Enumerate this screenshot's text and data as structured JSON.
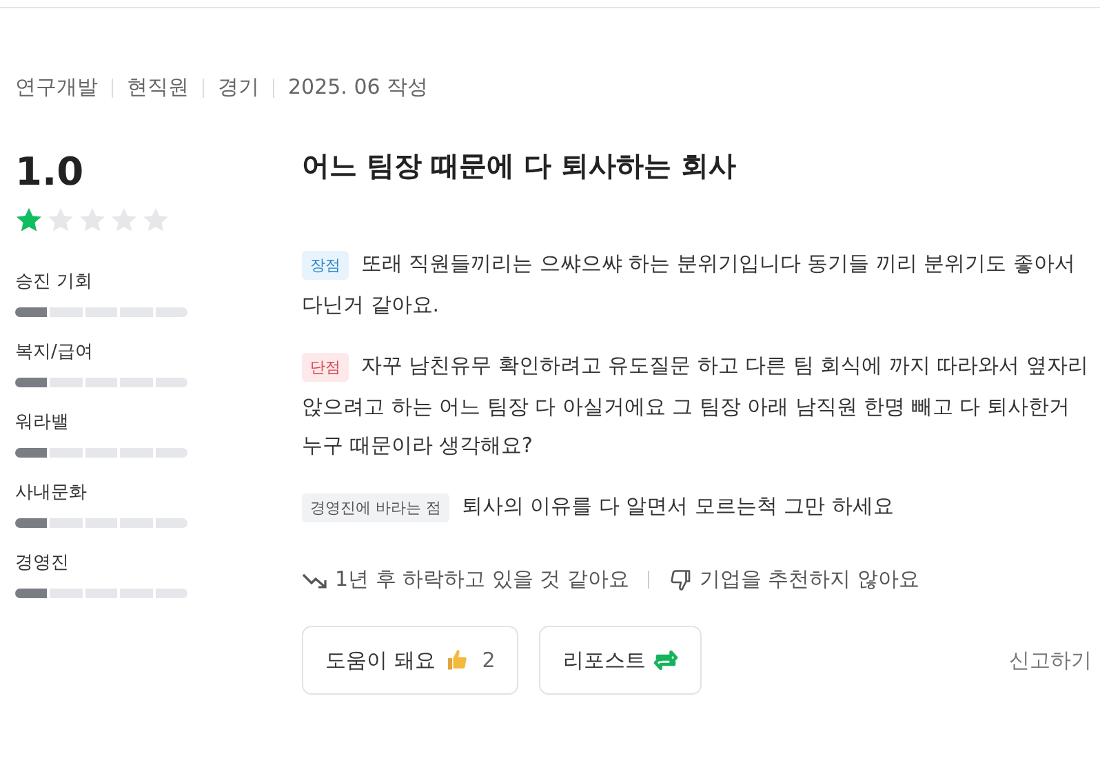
{
  "meta": [
    "연구개발",
    "현직원",
    "경기",
    "2025. 06 작성"
  ],
  "rating": {
    "score": "1.0",
    "stars": 1
  },
  "categories": [
    {
      "label": "승진 기회",
      "level": 0.2
    },
    {
      "label": "복지/급여",
      "level": 0.2
    },
    {
      "label": "워라밸",
      "level": 0.2
    },
    {
      "label": "사내문화",
      "level": 0.2
    },
    {
      "label": "경영진",
      "level": 0.2
    }
  ],
  "title": "어느 팀장 때문에 다 퇴사하는 회사",
  "sections": [
    {
      "kind": "pros",
      "tag": "장점",
      "text": "또래 직원들끼리는 으쌰으쌰 하는 분위기입니다 동기들 끼리 분위기도 좋아서 다닌거 같아요."
    },
    {
      "kind": "cons",
      "tag": "단점",
      "text": "자꾸 남친유무 확인하려고 유도질문 하고 다른 팀 회식에 까지 따라와서 옆자리 앉으려고 하는 어느 팀장 다 아실거에요 그 팀장 아래 남직원 한명 빼고 다 퇴사한거 누구 때문이라 생각해요?"
    },
    {
      "kind": "wish",
      "tag": "경영진에 바라는 점",
      "text": "퇴사의 이유를 다 알면서 모르는척 그만 하세요"
    }
  ],
  "outlook": "1년 후 하락하고 있을 것 같아요",
  "recommend": "기업을 추천하지 않아요",
  "helpful": {
    "label": "도움이 돼요",
    "count": "2"
  },
  "repost": "리포스트",
  "report": "신고하기"
}
